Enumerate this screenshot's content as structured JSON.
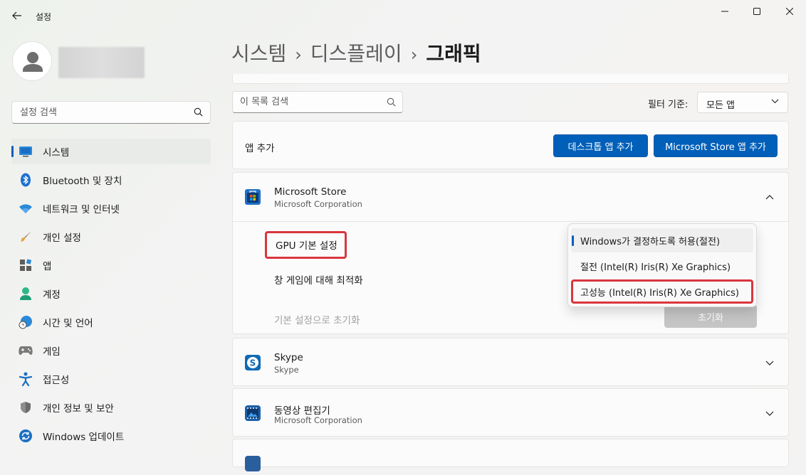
{
  "window": {
    "title": "설정"
  },
  "sidebar": {
    "search_placeholder": "설정 검색",
    "items": [
      {
        "label": "시스템",
        "icon": "monitor-icon",
        "active": true
      },
      {
        "label": "Bluetooth 및 장치",
        "icon": "bluetooth-icon"
      },
      {
        "label": "네트워크 및 인터넷",
        "icon": "wifi-icon"
      },
      {
        "label": "개인 설정",
        "icon": "paintbrush-icon"
      },
      {
        "label": "앱",
        "icon": "apps-icon"
      },
      {
        "label": "계정",
        "icon": "account-icon"
      },
      {
        "label": "시간 및 언어",
        "icon": "globe-clock-icon"
      },
      {
        "label": "게임",
        "icon": "gamepad-icon"
      },
      {
        "label": "접근성",
        "icon": "accessibility-icon"
      },
      {
        "label": "개인 정보 및 보안",
        "icon": "shield-icon"
      },
      {
        "label": "Windows 업데이트",
        "icon": "update-icon"
      }
    ]
  },
  "breadcrumb": {
    "parts": [
      "시스템",
      "디스플레이"
    ],
    "current": "그래픽",
    "separator": "›"
  },
  "list_search": {
    "placeholder": "이 목록 검색"
  },
  "filter": {
    "label": "필터 기준:",
    "value": "모든 앱"
  },
  "add_app": {
    "label": "앱 추가",
    "desktop_button": "데스크톱 앱 추가",
    "store_button": "Microsoft Store 앱 추가"
  },
  "apps": [
    {
      "name": "Microsoft Store",
      "publisher": "Microsoft Corporation",
      "expanded": true,
      "gpu_label": "GPU 기본 설정",
      "windowed_label": "창 게임에 대해 최적화",
      "reset_label": "기본 설정으로 초기화",
      "reset_button": "초기화",
      "gpu_options": [
        "Windows가 결정하도록 허용(절전)",
        "절전 (Intel(R) Iris(R) Xe Graphics)",
        "고성능 (Intel(R) Iris(R) Xe Graphics)"
      ]
    },
    {
      "name": "Skype",
      "publisher": "Skype"
    },
    {
      "name": "동영상 편집기",
      "publisher": "Microsoft Corporation"
    }
  ],
  "colors": {
    "accent": "#005fb8",
    "highlight": "#d9363e"
  }
}
